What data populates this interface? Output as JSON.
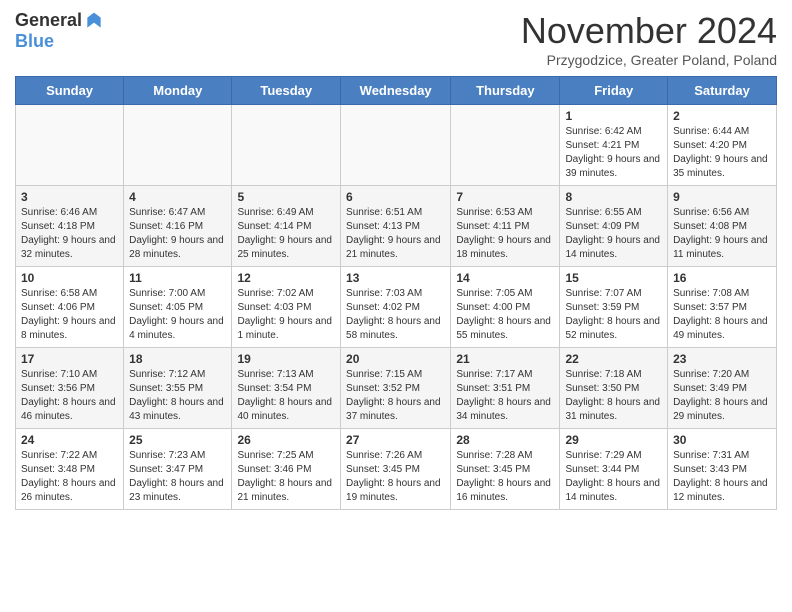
{
  "header": {
    "logo_general": "General",
    "logo_blue": "Blue",
    "month_title": "November 2024",
    "location": "Przygodzice, Greater Poland, Poland"
  },
  "days_of_week": [
    "Sunday",
    "Monday",
    "Tuesday",
    "Wednesday",
    "Thursday",
    "Friday",
    "Saturday"
  ],
  "weeks": [
    [
      {
        "day": "",
        "empty": true
      },
      {
        "day": "",
        "empty": true
      },
      {
        "day": "",
        "empty": true
      },
      {
        "day": "",
        "empty": true
      },
      {
        "day": "",
        "empty": true
      },
      {
        "day": "1",
        "sunrise": "Sunrise: 6:42 AM",
        "sunset": "Sunset: 4:21 PM",
        "daylight": "Daylight: 9 hours and 39 minutes."
      },
      {
        "day": "2",
        "sunrise": "Sunrise: 6:44 AM",
        "sunset": "Sunset: 4:20 PM",
        "daylight": "Daylight: 9 hours and 35 minutes."
      }
    ],
    [
      {
        "day": "3",
        "sunrise": "Sunrise: 6:46 AM",
        "sunset": "Sunset: 4:18 PM",
        "daylight": "Daylight: 9 hours and 32 minutes."
      },
      {
        "day": "4",
        "sunrise": "Sunrise: 6:47 AM",
        "sunset": "Sunset: 4:16 PM",
        "daylight": "Daylight: 9 hours and 28 minutes."
      },
      {
        "day": "5",
        "sunrise": "Sunrise: 6:49 AM",
        "sunset": "Sunset: 4:14 PM",
        "daylight": "Daylight: 9 hours and 25 minutes."
      },
      {
        "day": "6",
        "sunrise": "Sunrise: 6:51 AM",
        "sunset": "Sunset: 4:13 PM",
        "daylight": "Daylight: 9 hours and 21 minutes."
      },
      {
        "day": "7",
        "sunrise": "Sunrise: 6:53 AM",
        "sunset": "Sunset: 4:11 PM",
        "daylight": "Daylight: 9 hours and 18 minutes."
      },
      {
        "day": "8",
        "sunrise": "Sunrise: 6:55 AM",
        "sunset": "Sunset: 4:09 PM",
        "daylight": "Daylight: 9 hours and 14 minutes."
      },
      {
        "day": "9",
        "sunrise": "Sunrise: 6:56 AM",
        "sunset": "Sunset: 4:08 PM",
        "daylight": "Daylight: 9 hours and 11 minutes."
      }
    ],
    [
      {
        "day": "10",
        "sunrise": "Sunrise: 6:58 AM",
        "sunset": "Sunset: 4:06 PM",
        "daylight": "Daylight: 9 hours and 8 minutes."
      },
      {
        "day": "11",
        "sunrise": "Sunrise: 7:00 AM",
        "sunset": "Sunset: 4:05 PM",
        "daylight": "Daylight: 9 hours and 4 minutes."
      },
      {
        "day": "12",
        "sunrise": "Sunrise: 7:02 AM",
        "sunset": "Sunset: 4:03 PM",
        "daylight": "Daylight: 9 hours and 1 minute."
      },
      {
        "day": "13",
        "sunrise": "Sunrise: 7:03 AM",
        "sunset": "Sunset: 4:02 PM",
        "daylight": "Daylight: 8 hours and 58 minutes."
      },
      {
        "day": "14",
        "sunrise": "Sunrise: 7:05 AM",
        "sunset": "Sunset: 4:00 PM",
        "daylight": "Daylight: 8 hours and 55 minutes."
      },
      {
        "day": "15",
        "sunrise": "Sunrise: 7:07 AM",
        "sunset": "Sunset: 3:59 PM",
        "daylight": "Daylight: 8 hours and 52 minutes."
      },
      {
        "day": "16",
        "sunrise": "Sunrise: 7:08 AM",
        "sunset": "Sunset: 3:57 PM",
        "daylight": "Daylight: 8 hours and 49 minutes."
      }
    ],
    [
      {
        "day": "17",
        "sunrise": "Sunrise: 7:10 AM",
        "sunset": "Sunset: 3:56 PM",
        "daylight": "Daylight: 8 hours and 46 minutes."
      },
      {
        "day": "18",
        "sunrise": "Sunrise: 7:12 AM",
        "sunset": "Sunset: 3:55 PM",
        "daylight": "Daylight: 8 hours and 43 minutes."
      },
      {
        "day": "19",
        "sunrise": "Sunrise: 7:13 AM",
        "sunset": "Sunset: 3:54 PM",
        "daylight": "Daylight: 8 hours and 40 minutes."
      },
      {
        "day": "20",
        "sunrise": "Sunrise: 7:15 AM",
        "sunset": "Sunset: 3:52 PM",
        "daylight": "Daylight: 8 hours and 37 minutes."
      },
      {
        "day": "21",
        "sunrise": "Sunrise: 7:17 AM",
        "sunset": "Sunset: 3:51 PM",
        "daylight": "Daylight: 8 hours and 34 minutes."
      },
      {
        "day": "22",
        "sunrise": "Sunrise: 7:18 AM",
        "sunset": "Sunset: 3:50 PM",
        "daylight": "Daylight: 8 hours and 31 minutes."
      },
      {
        "day": "23",
        "sunrise": "Sunrise: 7:20 AM",
        "sunset": "Sunset: 3:49 PM",
        "daylight": "Daylight: 8 hours and 29 minutes."
      }
    ],
    [
      {
        "day": "24",
        "sunrise": "Sunrise: 7:22 AM",
        "sunset": "Sunset: 3:48 PM",
        "daylight": "Daylight: 8 hours and 26 minutes."
      },
      {
        "day": "25",
        "sunrise": "Sunrise: 7:23 AM",
        "sunset": "Sunset: 3:47 PM",
        "daylight": "Daylight: 8 hours and 23 minutes."
      },
      {
        "day": "26",
        "sunrise": "Sunrise: 7:25 AM",
        "sunset": "Sunset: 3:46 PM",
        "daylight": "Daylight: 8 hours and 21 minutes."
      },
      {
        "day": "27",
        "sunrise": "Sunrise: 7:26 AM",
        "sunset": "Sunset: 3:45 PM",
        "daylight": "Daylight: 8 hours and 19 minutes."
      },
      {
        "day": "28",
        "sunrise": "Sunrise: 7:28 AM",
        "sunset": "Sunset: 3:45 PM",
        "daylight": "Daylight: 8 hours and 16 minutes."
      },
      {
        "day": "29",
        "sunrise": "Sunrise: 7:29 AM",
        "sunset": "Sunset: 3:44 PM",
        "daylight": "Daylight: 8 hours and 14 minutes."
      },
      {
        "day": "30",
        "sunrise": "Sunrise: 7:31 AM",
        "sunset": "Sunset: 3:43 PM",
        "daylight": "Daylight: 8 hours and 12 minutes."
      }
    ]
  ]
}
